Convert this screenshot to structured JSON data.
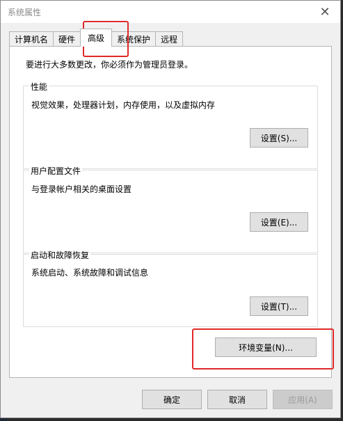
{
  "window": {
    "title": "系统属性",
    "close_glyph": "✕"
  },
  "tabs": [
    {
      "label": "计算机名"
    },
    {
      "label": "硬件"
    },
    {
      "label": "高级",
      "active": true
    },
    {
      "label": "系统保护"
    },
    {
      "label": "远程"
    }
  ],
  "panel": {
    "intro": "要进行大多数更改，你必须作为管理员登录。",
    "performance": {
      "title": "性能",
      "desc": "视觉效果，处理器计划，内存使用，以及虚拟内存",
      "button": "设置(S)..."
    },
    "profile": {
      "title": "用户配置文件",
      "desc": "与登录帐户相关的桌面设置",
      "button": "设置(E)..."
    },
    "startup": {
      "title": "启动和故障恢复",
      "desc": "系统启动、系统故障和调试信息",
      "button": "设置(T)..."
    },
    "env_button": "环境变量(N)..."
  },
  "footer": {
    "ok": "确定",
    "cancel": "取消",
    "apply": "应用(A)"
  },
  "colors": {
    "highlight": "#e02828"
  }
}
